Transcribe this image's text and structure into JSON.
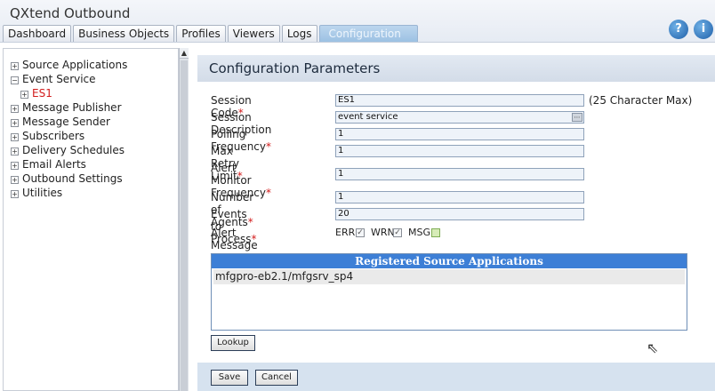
{
  "app": {
    "title": "QXtend Outbound"
  },
  "tabs": [
    {
      "label": "Dashboard",
      "active": false
    },
    {
      "label": "Business Objects",
      "active": false
    },
    {
      "label": "Profiles",
      "active": false
    },
    {
      "label": "Viewers",
      "active": false
    },
    {
      "label": "Logs",
      "active": false
    },
    {
      "label": "Configuration",
      "active": true
    }
  ],
  "header_icons": {
    "help": "?",
    "info": "i"
  },
  "sidebar": {
    "items": [
      {
        "label": "Source Applications",
        "expander": "+"
      },
      {
        "label": "Event Service",
        "expander": "−"
      },
      {
        "label": "ES1",
        "expander": "+",
        "child": true
      },
      {
        "label": "Message Publisher",
        "expander": "+"
      },
      {
        "label": "Message Sender",
        "expander": "+"
      },
      {
        "label": "Subscribers",
        "expander": "+"
      },
      {
        "label": "Delivery Schedules",
        "expander": "+"
      },
      {
        "label": "Email Alerts",
        "expander": "+"
      },
      {
        "label": "Outbound Settings",
        "expander": "+"
      },
      {
        "label": "Utilities",
        "expander": "+"
      }
    ]
  },
  "main": {
    "title": "Configuration Parameters",
    "fields": {
      "session_code": {
        "label": "Session Code",
        "required": "*",
        "value": "ES1",
        "hint": "(25 Character Max)"
      },
      "session_description": {
        "label": "Session Description",
        "value": "event service"
      },
      "polling_frequency": {
        "label": "Polling Frequency",
        "required": "*",
        "value": "1"
      },
      "max_retry_limit": {
        "label": "Max Retry Limit",
        "required": "*",
        "value": "1"
      },
      "alert_monitor_frequency": {
        "label_line1": "Alert Monitor",
        "label_line2": "Frequency",
        "required": "*",
        "value": "1"
      },
      "number_of_agents": {
        "label": "Number of Agents",
        "required": "*",
        "value": "1"
      },
      "events_to_process": {
        "label": "Events to Process",
        "required": "*",
        "value": "20"
      }
    },
    "alert_types": {
      "label": "Alert Message Types",
      "options": [
        {
          "label": "ERR",
          "checked": true
        },
        {
          "label": "WRN",
          "checked": true
        },
        {
          "label": "MSG",
          "checked": false
        }
      ]
    },
    "registered": {
      "header": "Registered Source Applications",
      "rows": [
        "mfgpro-eb2.1/mfgsrv_sp4"
      ]
    },
    "buttons": {
      "lookup": "Lookup",
      "save": "Save",
      "cancel": "Cancel"
    }
  },
  "colors": {
    "accent": "#3d7fd6",
    "required": "#d21b1b"
  }
}
